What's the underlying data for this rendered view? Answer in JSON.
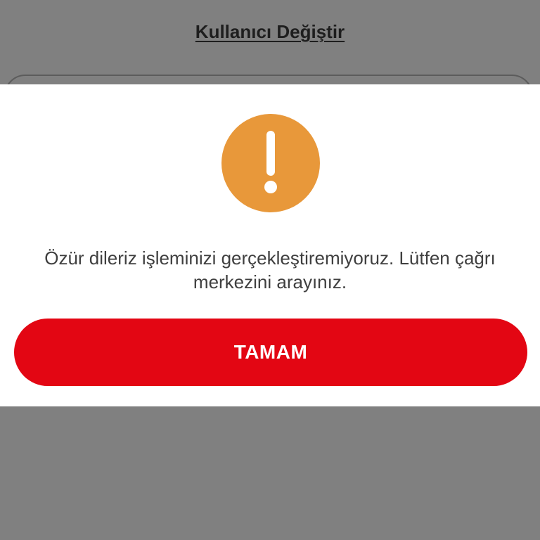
{
  "background": {
    "switch_user_link": "Kullanıcı Değiştir"
  },
  "dialog": {
    "icon": "exclamation-icon",
    "icon_color": "#e8983a",
    "message": "Özür dileriz işleminizi gerçekleştiremiyoruz. Lütfen çağrı merkezini arayınız.",
    "ok_label": "TAMAM",
    "button_color": "#e30613"
  }
}
